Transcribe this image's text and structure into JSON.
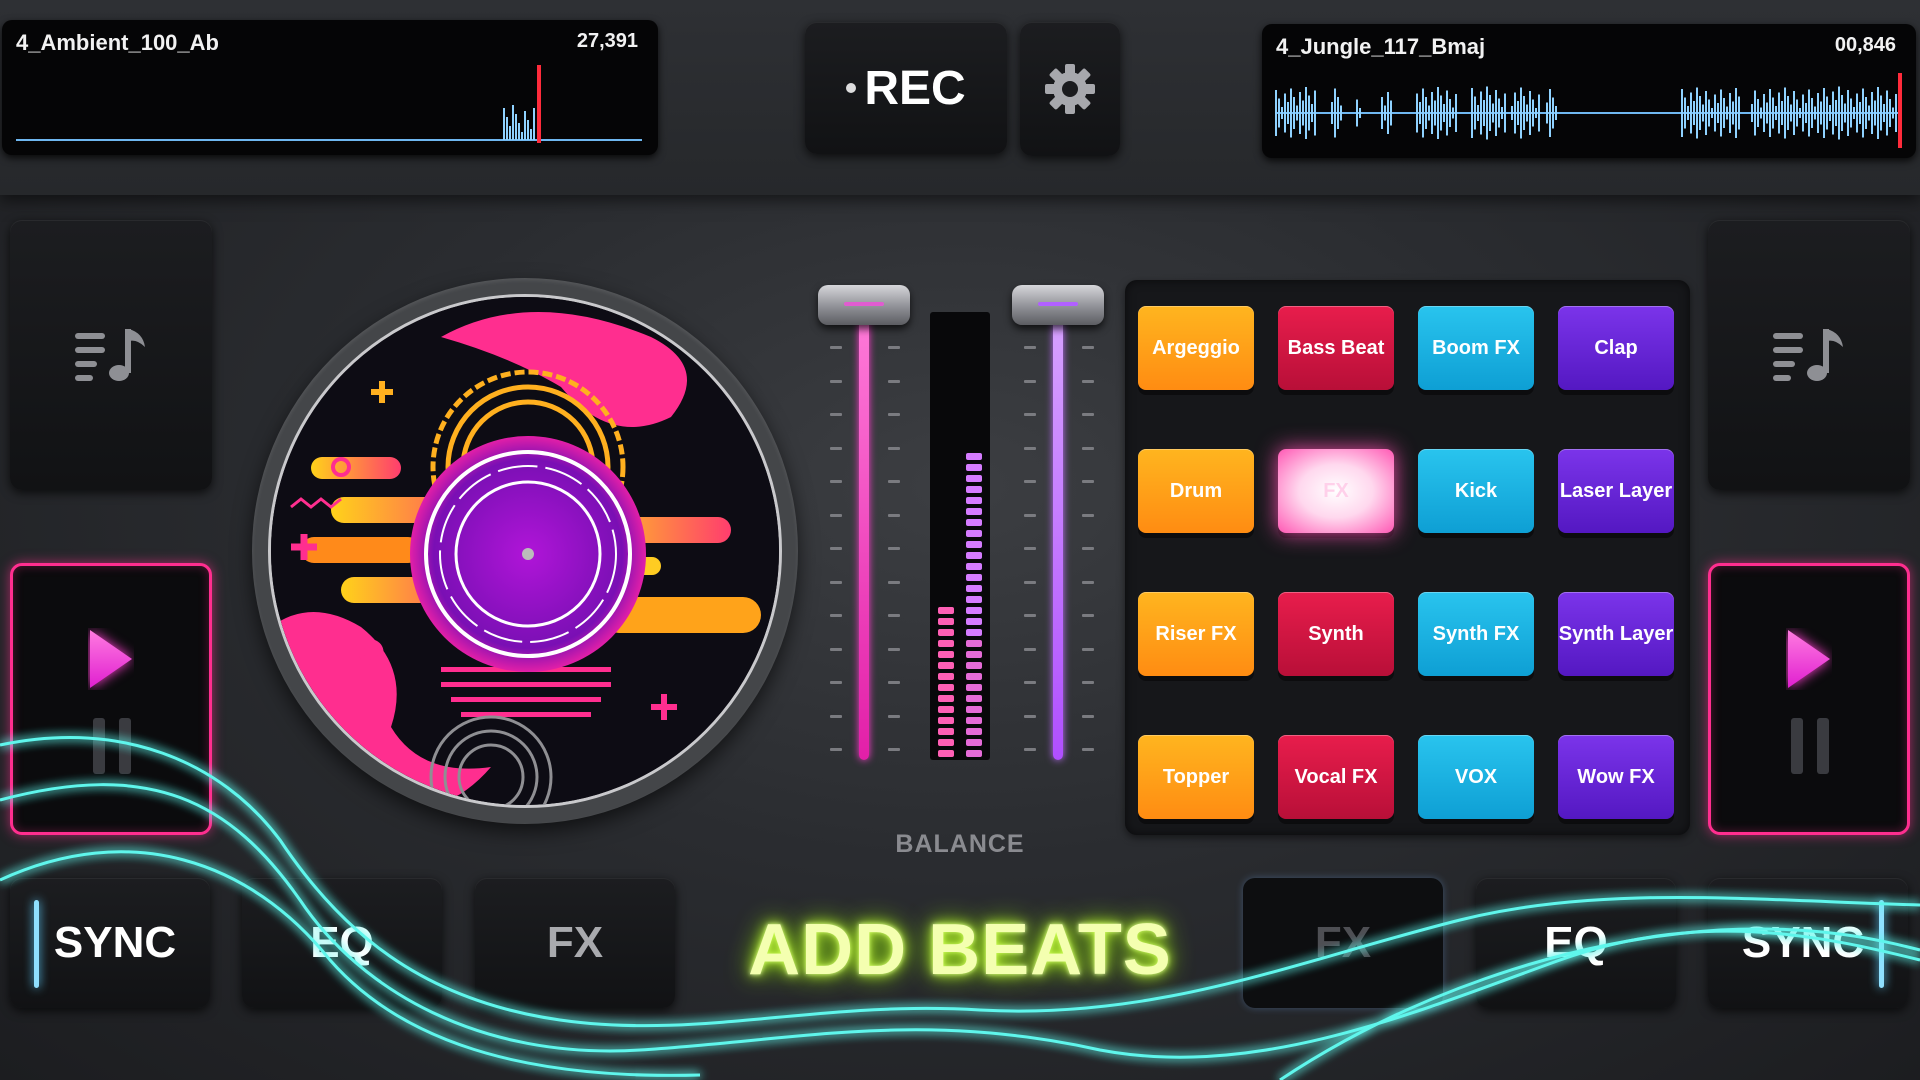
{
  "deck_left": {
    "track_title": "4_Ambient_100_Ab",
    "track_time": "27,391"
  },
  "deck_right": {
    "track_title": "4_Jungle_117_Bmaj",
    "track_time": "00,846"
  },
  "header": {
    "rec_label": "REC"
  },
  "mixer": {
    "balance_label": "BALANCE"
  },
  "pads": [
    {
      "label": "Argeggio",
      "color": "orange"
    },
    {
      "label": "Bass Beat",
      "color": "red"
    },
    {
      "label": "Boom FX",
      "color": "cyan"
    },
    {
      "label": "Clap",
      "color": "purple"
    },
    {
      "label": "Drum",
      "color": "orange"
    },
    {
      "label": "FX",
      "color": "red",
      "active": true
    },
    {
      "label": "Kick",
      "color": "cyan"
    },
    {
      "label": "Laser Layer",
      "color": "purple"
    },
    {
      "label": "Riser FX",
      "color": "orange"
    },
    {
      "label": "Synth",
      "color": "red"
    },
    {
      "label": "Synth FX",
      "color": "cyan"
    },
    {
      "label": "Synth Layer",
      "color": "purple"
    },
    {
      "label": "Topper",
      "color": "orange"
    },
    {
      "label": "Vocal FX",
      "color": "red"
    },
    {
      "label": "VOX",
      "color": "cyan"
    },
    {
      "label": "Wow FX",
      "color": "purple"
    }
  ],
  "bottom_left": {
    "sync_label": "SYNC",
    "eq_label": "EQ",
    "fx_label": "FX"
  },
  "bottom_right": {
    "fx_label": "FX",
    "eq_label": "EQ",
    "sync_label": "SYNC"
  },
  "promo": {
    "add_beats": "ADD BEATS"
  },
  "icons": {
    "library": "music-playlist-icon",
    "settings": "gear-icon",
    "play": "play-icon",
    "pause": "pause-icon"
  },
  "colors": {
    "accent_pink": "#ff2e8f",
    "accent_cyan": "#29c4ee",
    "accent_purple": "#7b34ea",
    "accent_orange": "#ff9a16",
    "glow_teal": "#3ff0e6",
    "promo_green": "#c9ff3a"
  }
}
